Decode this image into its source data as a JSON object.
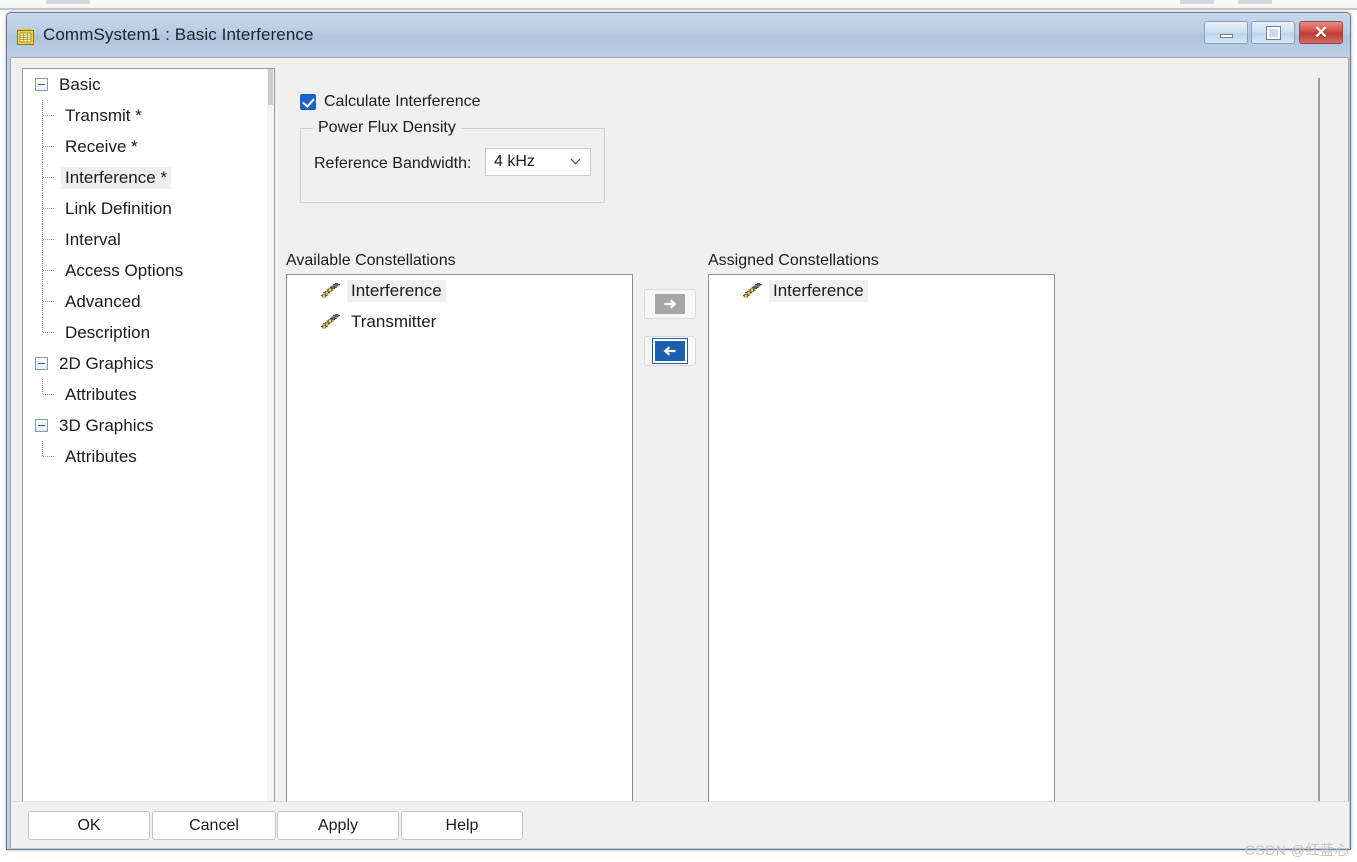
{
  "window": {
    "icon": "notepad-icon",
    "title": "CommSystem1 : Basic Interference",
    "controls": {
      "minimize": "minimize-icon",
      "maximize": "maximize-icon",
      "close": "✕"
    }
  },
  "tree": {
    "nodes": [
      {
        "label": "Basic",
        "level": "root",
        "expanded": true,
        "selected": false,
        "last": false
      },
      {
        "label": "Transmit *",
        "level": "child",
        "expanded": false,
        "selected": false,
        "last": false
      },
      {
        "label": "Receive *",
        "level": "child",
        "expanded": false,
        "selected": false,
        "last": false
      },
      {
        "label": "Interference *",
        "level": "child",
        "expanded": false,
        "selected": true,
        "last": false
      },
      {
        "label": "Link Definition",
        "level": "child",
        "expanded": false,
        "selected": false,
        "last": false
      },
      {
        "label": "Interval",
        "level": "child",
        "expanded": false,
        "selected": false,
        "last": false
      },
      {
        "label": "Access Options",
        "level": "child",
        "expanded": false,
        "selected": false,
        "last": false
      },
      {
        "label": "Advanced",
        "level": "child",
        "expanded": false,
        "selected": false,
        "last": false
      },
      {
        "label": "Description",
        "level": "child",
        "expanded": false,
        "selected": false,
        "last": true
      },
      {
        "label": "2D Graphics",
        "level": "root",
        "expanded": true,
        "selected": false,
        "last": false
      },
      {
        "label": "Attributes",
        "level": "child",
        "expanded": false,
        "selected": false,
        "last": true
      },
      {
        "label": "3D Graphics",
        "level": "root",
        "expanded": true,
        "selected": false,
        "last": false
      },
      {
        "label": "Attributes",
        "level": "child",
        "expanded": false,
        "selected": false,
        "last": true
      }
    ]
  },
  "content": {
    "calculate_interference": {
      "label": "Calculate Interference",
      "checked": true
    },
    "power_flux_density": {
      "legend": "Power Flux Density",
      "reference_bandwidth_label": "Reference Bandwidth:",
      "reference_bandwidth_value": "4 kHz"
    },
    "available": {
      "caption": "Available Constellations",
      "items": [
        {
          "label": "Interference",
          "icon": "constellation-icon",
          "selected": true
        },
        {
          "label": "Transmitter",
          "icon": "constellation-icon",
          "selected": false
        }
      ]
    },
    "assigned": {
      "caption": "Assigned Constellations",
      "items": [
        {
          "label": "Interference",
          "icon": "constellation-icon",
          "selected": true
        }
      ]
    },
    "transfer": {
      "assign_icon": "arrow-right-icon",
      "unassign_icon": "arrow-left-icon"
    }
  },
  "footer": {
    "buttons": [
      {
        "label": "OK"
      },
      {
        "label": "Cancel"
      },
      {
        "label": "Apply"
      },
      {
        "label": "Help"
      }
    ]
  },
  "watermark": "CSDN @红蓝心",
  "colors": {
    "titlebar": "#b6cbe3",
    "accent": "#1a64c8",
    "pane_bg": "#f0f0f0",
    "close_button": "#cf4f46",
    "disabled_arrow": "#a6a6a6",
    "enabled_arrow": "#1b5fae",
    "selection": "#efefef"
  }
}
